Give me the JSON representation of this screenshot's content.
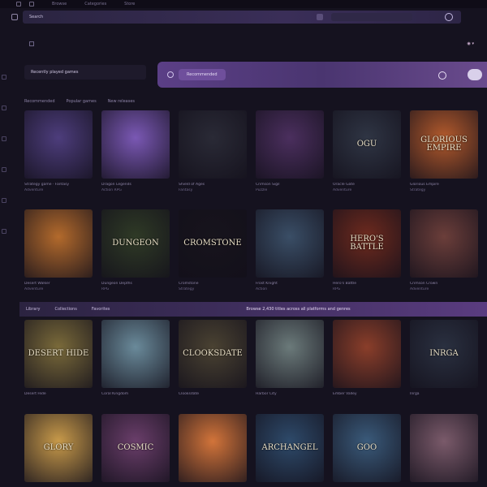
{
  "topbar": {
    "menus": [
      "Browse",
      "Categories",
      "Store"
    ]
  },
  "search": {
    "placeholder": "Search"
  },
  "library": {
    "title": "Recently played games"
  },
  "promo": {
    "pill": "Recommended"
  },
  "sections": {
    "row1": [
      "Recommended",
      "Popular games",
      "New releases"
    ],
    "band": [
      "Library",
      "Collections",
      "Favorites"
    ],
    "band_note": "Browse 2,430 titles across all platforms and genres"
  },
  "rows": [
    {
      "cards": [
        {
          "title": "",
          "cap": "Strategy game · Fantasy",
          "cap2": "Adventure",
          "bg": "#4d3d7c"
        },
        {
          "title": "",
          "cap": "Dragon Legends",
          "cap2": "Action RPG",
          "bg": "#7a58b4"
        },
        {
          "title": "",
          "cap": "Shield of Ages",
          "cap2": "Fantasy",
          "bg": "#2a2a36"
        },
        {
          "title": "",
          "cap": "Crimson Sigil",
          "cap2": "Puzzle",
          "bg": "#4b2f5e"
        },
        {
          "title": "OGU",
          "cap": "Oracle Gate",
          "cap2": "Adventure",
          "bg": "#2f3544"
        },
        {
          "title": "GLORIOUS EMPIRE",
          "cap": "Glorious Empire",
          "cap2": "Strategy",
          "bg": "#b35a2c"
        }
      ]
    },
    {
      "cards": [
        {
          "title": "",
          "cap": "Desert Walker",
          "cap2": "Adventure",
          "bg": "#b36a2c"
        },
        {
          "title": "DUNGEON",
          "cap": "Dungeon Depths",
          "cap2": "RPG",
          "bg": "#2f3a26"
        },
        {
          "title": "CROMSTONE",
          "cap": "Cromstone",
          "cap2": "Strategy",
          "bg": "#17141c"
        },
        {
          "title": "",
          "cap": "Frost Knight",
          "cap2": "Action",
          "bg": "#3a4e66"
        },
        {
          "title": "HERO'S BATTLE",
          "cap": "Hero's Battle",
          "cap2": "RPG",
          "bg": "#6e2a1e"
        },
        {
          "title": "",
          "cap": "Crimson Crown",
          "cap2": "Adventure",
          "bg": "#6b3e3a"
        }
      ]
    },
    {
      "cards": [
        {
          "title": "DESERT HIDE",
          "cap": "Desert Hide",
          "cap2": "",
          "bg": "#7a6a3a"
        },
        {
          "title": "",
          "cap": "Coral Kingdom",
          "cap2": "",
          "bg": "#6a8a9a"
        },
        {
          "title": "CLOOKSDATE",
          "cap": "Clooksdate",
          "cap2": "",
          "bg": "#4a4232"
        },
        {
          "title": "",
          "cap": "Harbor City",
          "cap2": "",
          "bg": "#6b7a7a"
        },
        {
          "title": "",
          "cap": "Ember Valley",
          "cap2": "",
          "bg": "#8a3e2a"
        },
        {
          "title": "INRGA",
          "cap": "Inrga",
          "cap2": "",
          "bg": "#2a3040"
        }
      ]
    },
    {
      "cards": [
        {
          "title": "GLORY",
          "cap": "",
          "cap2": "",
          "bg": "#c89a4a"
        },
        {
          "title": "COSMIC",
          "cap": "",
          "cap2": "",
          "bg": "#6a3e6a"
        },
        {
          "title": "",
          "cap": "",
          "cap2": "",
          "bg": "#d2743a"
        },
        {
          "title": "ARCHANGEL",
          "cap": "",
          "cap2": "",
          "bg": "#2e4a6a"
        },
        {
          "title": "GOO",
          "cap": "",
          "cap2": "",
          "bg": "#3a5a7a"
        },
        {
          "title": "",
          "cap": "",
          "cap2": "",
          "bg": "#7a5a6a"
        }
      ]
    }
  ]
}
